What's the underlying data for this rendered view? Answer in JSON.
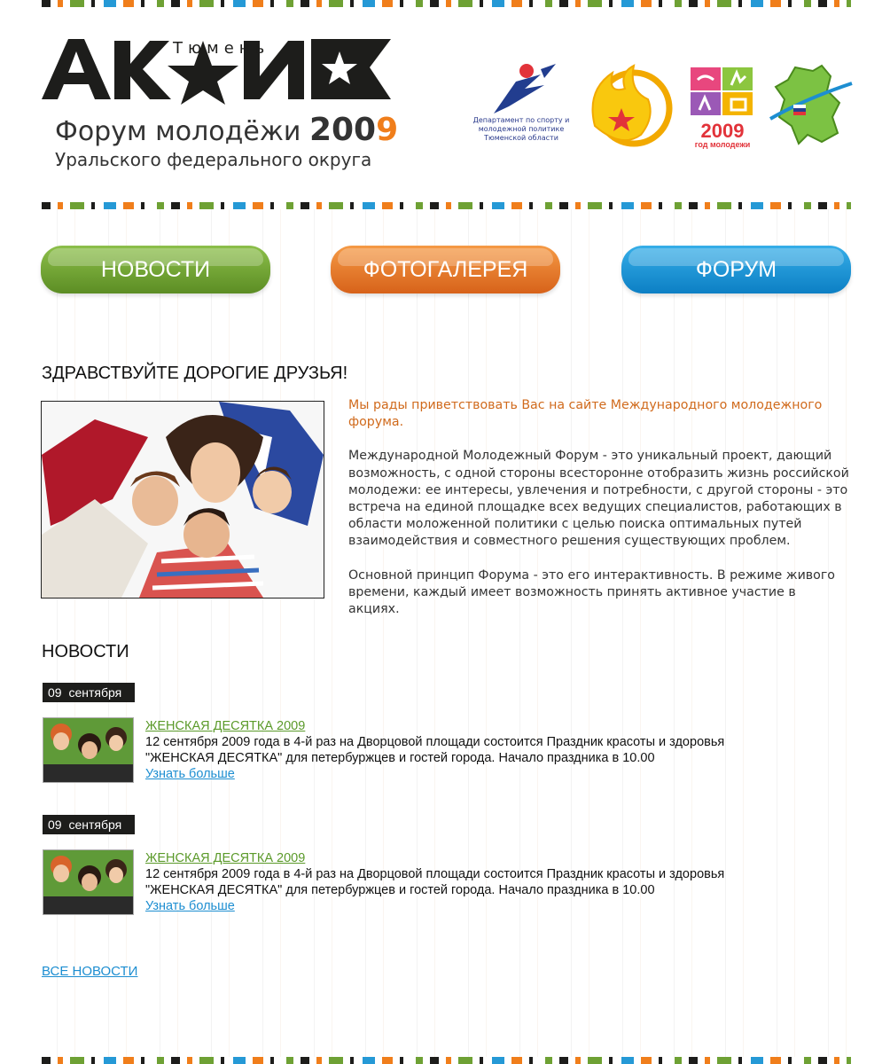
{
  "header": {
    "logo_city": "Тюмень",
    "logo_word": "АКТИВ",
    "logo_forum_text": "Форум молодёжи",
    "logo_year_prefix": "200",
    "logo_year_suffix": "9",
    "logo_subtitle": "Уральского федерального округа",
    "partner_dept_caption": "Департамент по спорту и молодежной политике Тюменской области",
    "partner_youth_year": "2009",
    "partner_youth_year_caption": "год молодежи",
    "colors": {
      "black": "#1d1d1b",
      "orange": "#f07e1b",
      "green": "#6ea134",
      "blue": "#2599d6"
    }
  },
  "nav": {
    "news": "НОВОСТИ",
    "gallery": "ФОТОГАЛЕРЕЯ",
    "forum": "ФОРУМ"
  },
  "welcome": {
    "heading": "ЗДРАВСТВУЙТЕ ДОРОГИЕ ДРУЗЬЯ!",
    "lead": "Мы рады приветствовать Вас на сайте Международного молодежного форума.",
    "paragraph1": "Международной Молодежный Форум - это уникальный проект, дающий возможность, с одной стороны всесторонне отобразить жизнь российской молодежи: ее интересы, увлечения и потребности, с другой стороны - это встреча на единой площадке всех ведущих специалистов, работающих в области моложенной политики с целью поиска оптимальных путей взаимодействия и совместного решения существующих проблем.",
    "paragraph2": "Основной принцип Форума - это его интерактивность. В режиме живого времени, каждый имеет возможность принять активное участие в акциях."
  },
  "news": {
    "heading": "НОВОСТИ",
    "items": [
      {
        "date": "09 сентября",
        "title": "ЖЕНСКАЯ ДЕСЯТКА 2009",
        "text": "12 сентября 2009 года в 4-й раз на Дворцовой площади состоится Праздник красоты и здоровья \"ЖЕНСКАЯ ДЕСЯТКА\" для петербуржцев и гостей города. Начало праздника в 10.00",
        "more": "Узнать больше"
      },
      {
        "date": "09 сентября",
        "title": "ЖЕНСКАЯ ДЕСЯТКА 2009",
        "text": "12 сентября 2009 года в 4-й раз на Дворцовой площади состоится Праздник красоты и здоровья \"ЖЕНСКАЯ ДЕСЯТКА\" для петербуржцев и гостей города. Начало праздника в 10.00",
        "more": "Узнать больше"
      }
    ],
    "all_news": "ВСЕ НОВОСТИ"
  }
}
